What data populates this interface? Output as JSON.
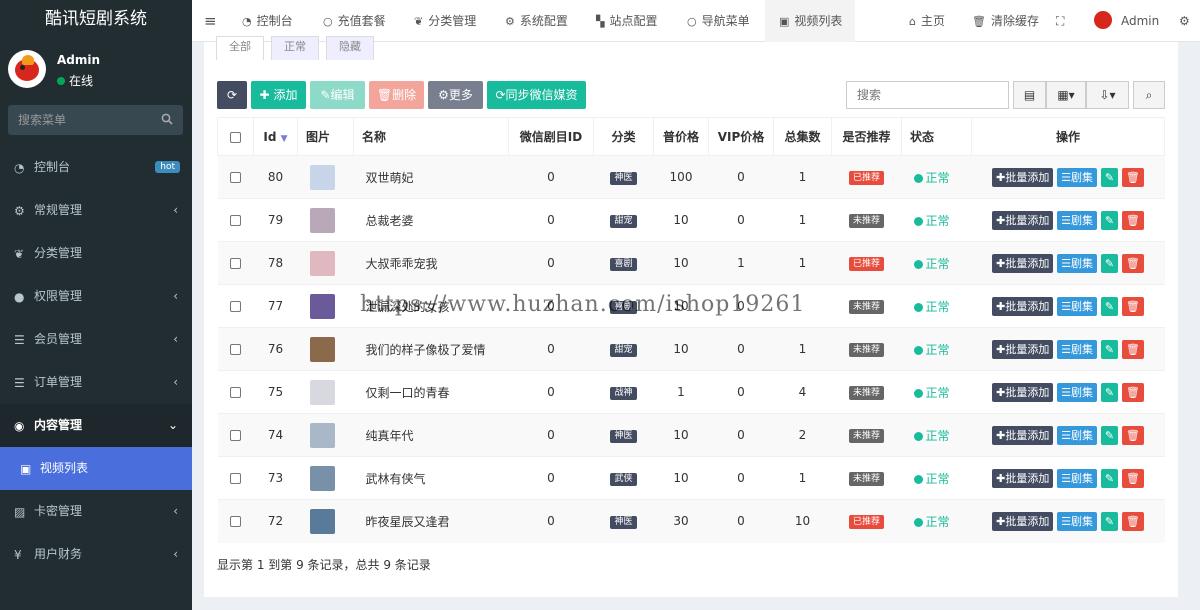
{
  "app_title": "酷讯短剧系统",
  "user": {
    "name": "Admin",
    "status": "在线"
  },
  "sidebar": {
    "search_placeholder": "搜索菜单",
    "items": [
      {
        "label": "控制台",
        "badge": "hot"
      },
      {
        "label": "常规管理"
      },
      {
        "label": "分类管理"
      },
      {
        "label": "权限管理"
      },
      {
        "label": "会员管理"
      },
      {
        "label": "订单管理"
      },
      {
        "label": "内容管理"
      },
      {
        "label": "视频列表"
      },
      {
        "label": "卡密管理"
      },
      {
        "label": "用户财务"
      }
    ]
  },
  "topnav": {
    "items": [
      "控制台",
      "充值套餐",
      "分类管理",
      "系统配置",
      "站点配置",
      "导航菜单",
      "视频列表"
    ],
    "right": {
      "home": "主页",
      "clear_cache": "清除缓存",
      "user": "Admin"
    }
  },
  "tabs": [
    "全部",
    "正常",
    "隐藏"
  ],
  "toolbar": {
    "add": "添加",
    "edit": "编辑",
    "delete": "删除",
    "more": "更多",
    "sync": "同步微信媒资",
    "search_placeholder": "搜索"
  },
  "table": {
    "headers": [
      "Id",
      "图片",
      "名称",
      "微信剧目ID",
      "分类",
      "普价格",
      "VIP价格",
      "总集数",
      "是否推荐",
      "状态",
      "操作"
    ],
    "rows": [
      {
        "id": "80",
        "name": "双世萌妃",
        "wxid": "0",
        "cat": "神医",
        "price": "100",
        "vip": "0",
        "eps": "1",
        "rec": "已推荐",
        "status": "正常"
      },
      {
        "id": "79",
        "name": "总裁老婆",
        "wxid": "0",
        "cat": "甜宠",
        "price": "10",
        "vip": "0",
        "eps": "1",
        "rec": "未推荐",
        "status": "正常"
      },
      {
        "id": "78",
        "name": "大叔乖乖宠我",
        "wxid": "0",
        "cat": "喜剧",
        "price": "10",
        "vip": "1",
        "eps": "1",
        "rec": "已推荐",
        "status": "正常"
      },
      {
        "id": "77",
        "name": "泄漏深处的女孩",
        "wxid": "0",
        "cat": "喜剧",
        "price": "10",
        "vip": "0",
        "eps": "",
        "rec": "未推荐",
        "status": "正常"
      },
      {
        "id": "76",
        "name": "我们的样子像极了爱情",
        "wxid": "0",
        "cat": "甜宠",
        "price": "10",
        "vip": "0",
        "eps": "1",
        "rec": "未推荐",
        "status": "正常"
      },
      {
        "id": "75",
        "name": "仅剩一口的青春",
        "wxid": "0",
        "cat": "战神",
        "price": "1",
        "vip": "0",
        "eps": "4",
        "rec": "未推荐",
        "status": "正常"
      },
      {
        "id": "74",
        "name": "纯真年代",
        "wxid": "0",
        "cat": "神医",
        "price": "10",
        "vip": "0",
        "eps": "2",
        "rec": "未推荐",
        "status": "正常"
      },
      {
        "id": "73",
        "name": "武林有侠气",
        "wxid": "0",
        "cat": "武侠",
        "price": "10",
        "vip": "0",
        "eps": "1",
        "rec": "未推荐",
        "status": "正常"
      },
      {
        "id": "72",
        "name": "昨夜星辰又逢君",
        "wxid": "0",
        "cat": "神医",
        "price": "30",
        "vip": "0",
        "eps": "10",
        "rec": "已推荐",
        "status": "正常"
      }
    ],
    "actions": {
      "batch_add": "批量添加",
      "episodes": "剧集"
    }
  },
  "footer": "显示第 1 到第 9 条记录，总共 9 条记录",
  "watermark": "https://www.huzhan.com/ishop19261",
  "colors": {
    "sidebar_bg": "#222d32",
    "accent": "#18bc9c",
    "primary_dark": "#444c62",
    "danger": "#e74c3c",
    "active_menu": "#4a6fdc"
  }
}
